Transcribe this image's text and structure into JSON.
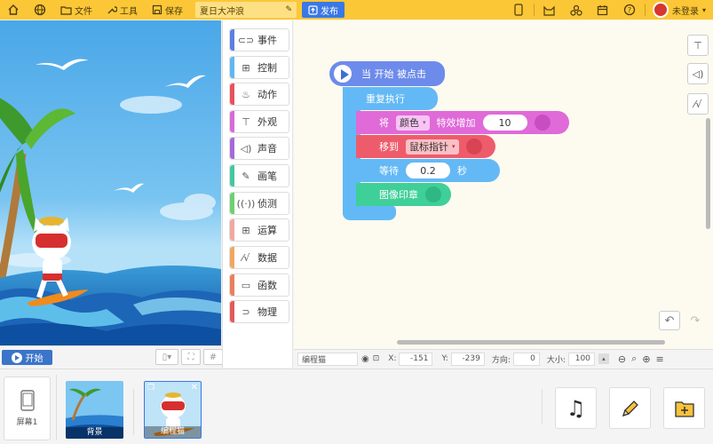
{
  "topbar": {
    "file": "文件",
    "tools": "工具",
    "save": "保存",
    "project_title": "夏日大冲浪",
    "publish": "发布",
    "user": "未登录"
  },
  "stage": {
    "start_label": "开始"
  },
  "categories": [
    {
      "label": "事件",
      "color": "#5b80e0",
      "icon": "toggle-icon"
    },
    {
      "label": "控制",
      "color": "#5fb7f0",
      "icon": "gamepad-icon"
    },
    {
      "label": "动作",
      "color": "#e8515e",
      "icon": "run-icon"
    },
    {
      "label": "外观",
      "color": "#d86ad8",
      "icon": "shirt-icon"
    },
    {
      "label": "声音",
      "color": "#a56ad8",
      "icon": "speaker-icon"
    },
    {
      "label": "画笔",
      "color": "#43c8a2",
      "icon": "pen-icon"
    },
    {
      "label": "侦测",
      "color": "#6ed06e",
      "icon": "sensor-icon"
    },
    {
      "label": "运算",
      "color": "#f0a8a0",
      "icon": "calc-icon"
    },
    {
      "label": "数据",
      "color": "#f0a860",
      "icon": "data-icon"
    },
    {
      "label": "函数",
      "color": "#e88060",
      "icon": "function-icon"
    },
    {
      "label": "物理",
      "color": "#e25a5a",
      "icon": "magnet-icon"
    }
  ],
  "script": {
    "hat": "当 开始 被点击",
    "repeat": "重复执行",
    "effect_prefix": "将",
    "effect_param": "颜色",
    "effect_suffix": "特效增加",
    "effect_value": "10",
    "goto_prefix": "移到",
    "goto_target": "鼠标指针",
    "wait_prefix": "等待",
    "wait_value": "0.2",
    "wait_suffix": "秒",
    "stamp": "图像印章"
  },
  "infobar": {
    "sprite_name": "编程猫",
    "x_label": "X:",
    "x_value": "-151",
    "y_label": "Y:",
    "y_value": "-239",
    "dir_label": "方向:",
    "dir_value": "0",
    "size_label": "大小:",
    "size_value": "100"
  },
  "bottom": {
    "screen_label": "屏幕1",
    "sprites": [
      {
        "label": "背景"
      },
      {
        "label": "编程猫"
      }
    ]
  },
  "colors": {
    "topbar": "#fcc736",
    "publish": "#3a78e6",
    "event_block": "#6d8bea",
    "control_block": "#63b9f5",
    "looks_block": "#e06ad8",
    "motion_block": "#ee5c6c",
    "pen_block": "#3fcf99"
  }
}
